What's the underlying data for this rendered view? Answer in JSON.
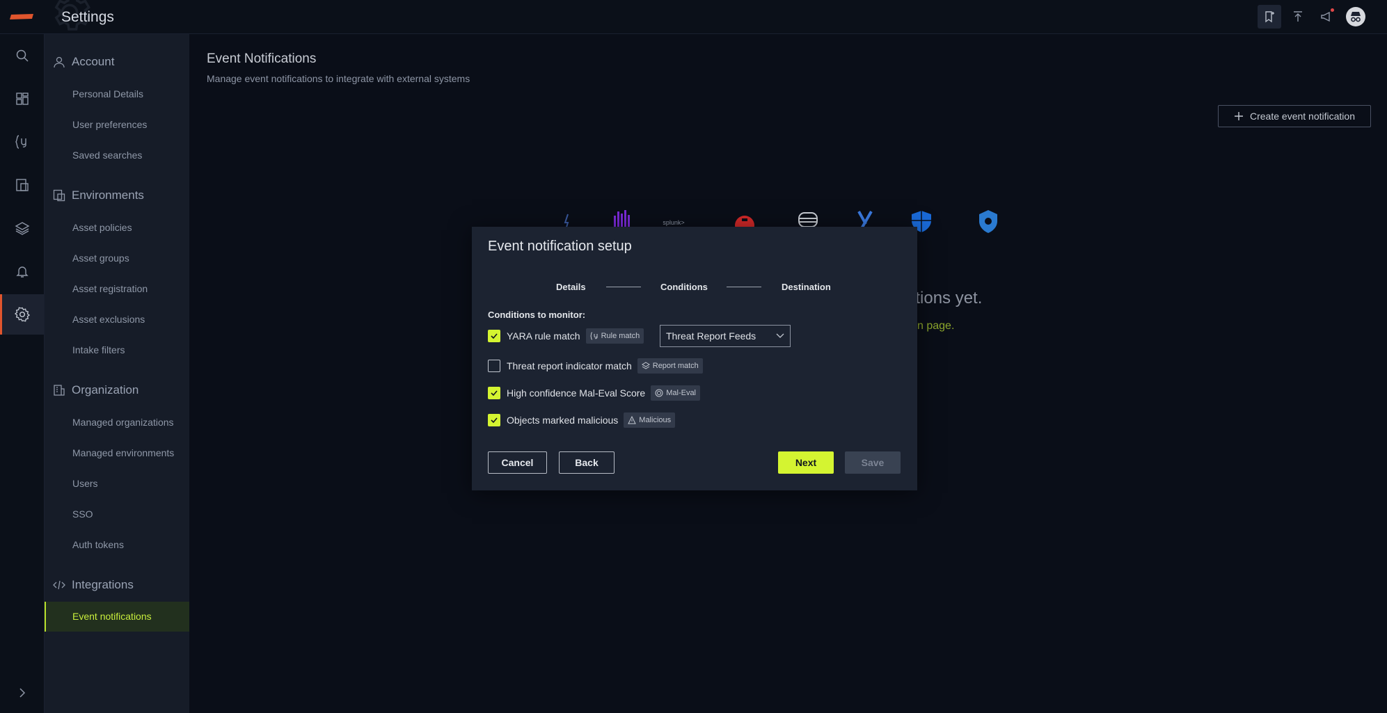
{
  "app": {
    "title": "Settings"
  },
  "sidebar": {
    "sections": [
      {
        "label": "Account",
        "icon": "user-icon",
        "items": [
          "Personal Details",
          "User preferences",
          "Saved searches"
        ]
      },
      {
        "label": "Environments",
        "icon": "environments-icon",
        "items": [
          "Asset policies",
          "Asset groups",
          "Asset registration",
          "Asset exclusions",
          "Intake filters"
        ]
      },
      {
        "label": "Organization",
        "icon": "building-icon",
        "items": [
          "Managed organizations",
          "Managed environments",
          "Users",
          "SSO",
          "Auth tokens"
        ]
      },
      {
        "label": "Integrations",
        "icon": "code-icon",
        "items": [
          "Event notifications"
        ]
      }
    ],
    "active_item": "Event notifications"
  },
  "page": {
    "title": "Event Notifications",
    "subtitle": "Manage event notifications to integrate with external systems",
    "create_button": "Create event notification",
    "empty_title_partial": "fications yet.",
    "empty_link_partial": "n page.",
    "splunk_label": "splunk>"
  },
  "modal": {
    "title": "Event notification setup",
    "steps": [
      "Details",
      "Conditions",
      "Destination"
    ],
    "conditions_label": "Conditions to monitor:",
    "conditions": [
      {
        "label": "YARA rule match",
        "checked": true,
        "tag": "Rule match",
        "tag_icon": "yara-icon"
      },
      {
        "label": "Threat report indicator match",
        "checked": false,
        "tag": "Report match",
        "tag_icon": "layers-icon"
      },
      {
        "label": "High confidence Mal-Eval Score",
        "checked": true,
        "tag": "Mal-Eval",
        "tag_icon": "target-icon"
      },
      {
        "label": "Objects marked malicious",
        "checked": true,
        "tag": "Malicious",
        "tag_icon": "warning-icon"
      }
    ],
    "select_value": "Threat Report Feeds",
    "buttons": {
      "cancel": "Cancel",
      "back": "Back",
      "next": "Next",
      "save": "Save"
    }
  },
  "colors": {
    "accent": "#d4f431",
    "brand": "#e0552d",
    "bg": "#0a0e18",
    "sidebar": "#161c28",
    "modal": "#1c2331"
  }
}
